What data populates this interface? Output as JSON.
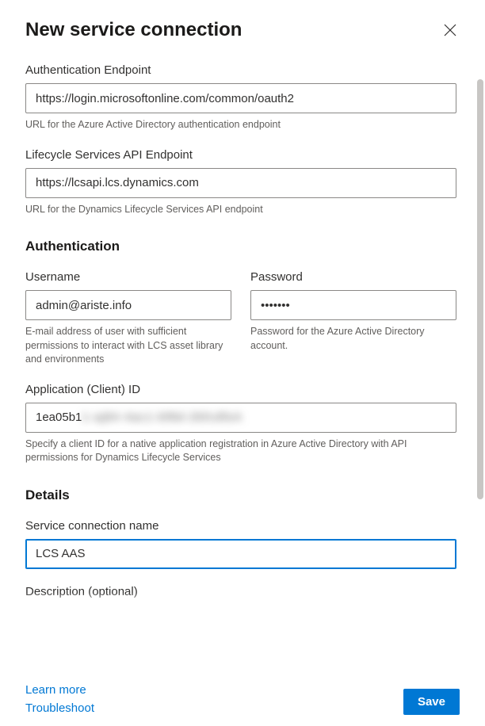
{
  "dialog": {
    "title": "New service connection"
  },
  "authEndpoint": {
    "label": "Authentication Endpoint",
    "value": "https://login.microsoftonline.com/common/oauth2",
    "help": "URL for the Azure Active Directory authentication endpoint"
  },
  "lcsEndpoint": {
    "label": "Lifecycle Services API Endpoint",
    "value": "https://lcsapi.lcs.dynamics.com",
    "help": "URL for the Dynamics Lifecycle Services API endpoint"
  },
  "authentication": {
    "heading": "Authentication",
    "username": {
      "label": "Username",
      "value": "admin@ariste.info",
      "help": "E-mail address of user with sufficient permissions to interact with LCS asset library and environments"
    },
    "password": {
      "label": "Password",
      "value": "•••••••",
      "help": "Password for the Azure Active Directory account."
    },
    "appId": {
      "label": "Application (Client) ID",
      "prefix": "1ea05b1",
      "obscured": "1-aj84-4ac1-bf8d-2bfcdfeA",
      "help": "Specify a client ID for a native application registration in Azure Active Directory with API permissions for Dynamics Lifecycle Services"
    }
  },
  "details": {
    "heading": "Details",
    "connectionName": {
      "label": "Service connection name",
      "value": "LCS AAS"
    },
    "descriptionLabel": "Description (optional)"
  },
  "footer": {
    "learnMore": "Learn more",
    "troubleshoot": "Troubleshoot",
    "save": "Save"
  }
}
